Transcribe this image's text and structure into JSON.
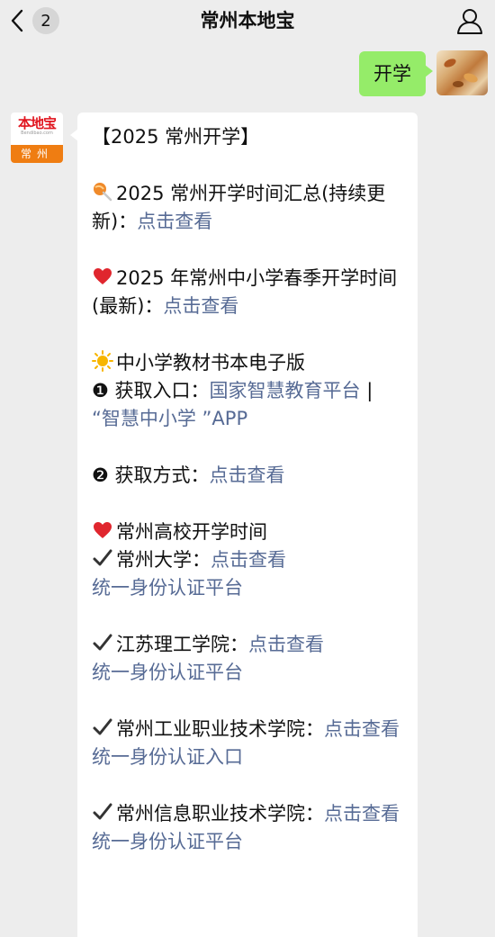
{
  "header": {
    "back_count": "2",
    "title": "常州本地宝"
  },
  "outgoing": {
    "text": "开学"
  },
  "bot": {
    "logo": "本地宝",
    "logo_sub": "Bendibao.com",
    "city": "常州"
  },
  "message": {
    "heading": "【2025 常州开学】",
    "item1": {
      "text": "2025 常州开学时间汇总(持续更新)：",
      "link": "点击查看"
    },
    "item2": {
      "text": "2025 年常州中小学春季开学时间(最新)：",
      "link": "点击查看"
    },
    "textbook": {
      "title": "中小学教材书本电子版",
      "entry_label": "❶ 获取入口：",
      "entry_link1": "国家智慧教育平台",
      "entry_sep": " | ",
      "entry_link2": "“智慧中小学 ”APP",
      "method_label": "❷ 获取方式：",
      "method_link": "点击查看"
    },
    "colleges": {
      "title": "常州高校开学时间",
      "list": [
        {
          "name": "常州大学：",
          "link": "点击查看",
          "portal": "统一身份认证平台"
        },
        {
          "name": "江苏理工学院：",
          "link": "点击查看",
          "portal": "统一身份认证平台"
        },
        {
          "name": "常州工业职业技术学院：",
          "link": "点击查看",
          "portal": "统一身份认证入口"
        },
        {
          "name": "常州信息职业技术学院：",
          "link": "点击查看",
          "portal": "统一身份认证平台"
        }
      ]
    }
  },
  "colors": {
    "background": "#ededed",
    "outgoing_bubble": "#95ec69",
    "link": "#576b95",
    "brand_orange": "#ef7d12",
    "brand_red": "#e1141e"
  }
}
